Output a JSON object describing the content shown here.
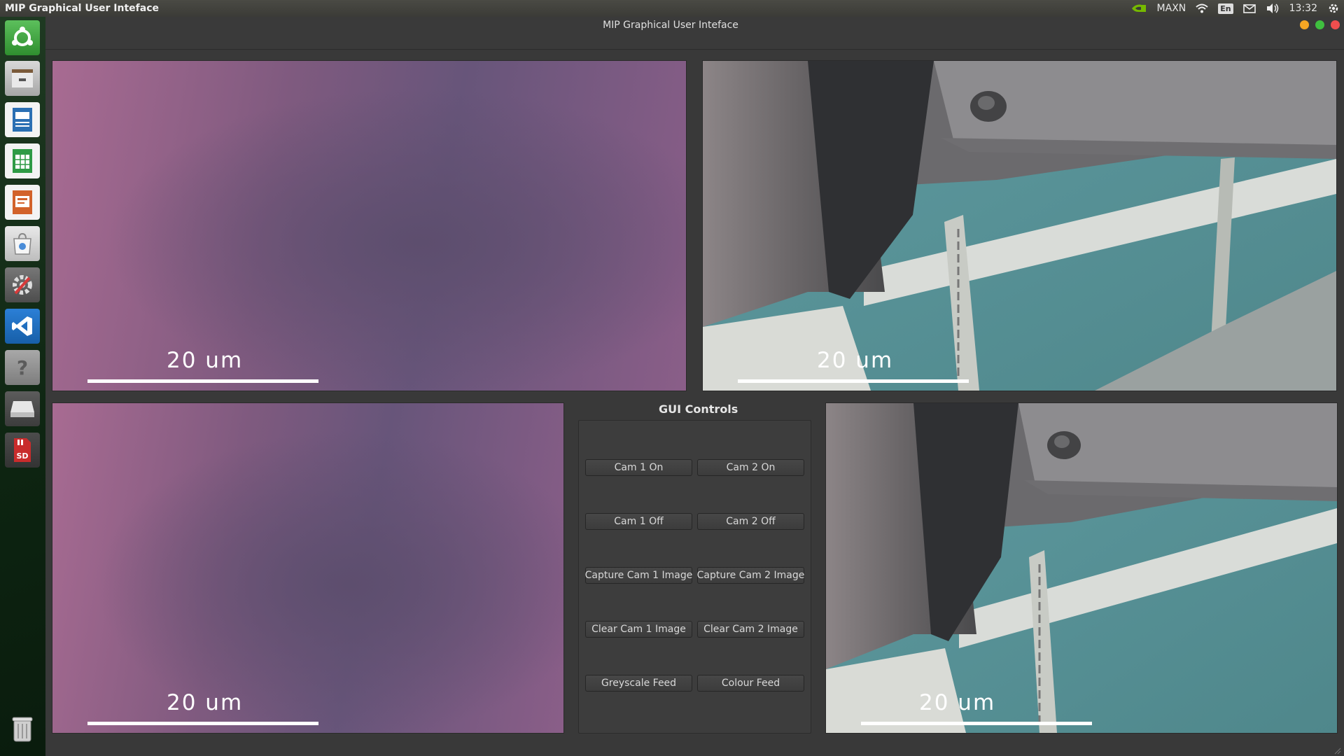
{
  "top_panel": {
    "app_title": "MIP Graphical User Inteface",
    "power_mode": "MAXN",
    "keyboard_layout": "En",
    "clock": "13:32",
    "icons": [
      "nvidia-icon",
      "wifi-icon",
      "keyboard-icon",
      "mail-icon",
      "volume-icon",
      "settings-gear-icon"
    ]
  },
  "launcher": {
    "items": [
      "ubuntu-dash-icon",
      "file-manager-icon",
      "libreoffice-writer-icon",
      "libreoffice-calc-icon",
      "libreoffice-impress-icon",
      "software-center-icon",
      "system-settings-icon",
      "vscode-icon",
      "help-icon",
      "drive-icon",
      "sd-card-icon",
      "trash-icon"
    ]
  },
  "window": {
    "title": "MIP Graphical User Inteface",
    "close_color": "#f04e4e",
    "minimize_color": "#f5a623",
    "maximize_color": "#3fbf3f"
  },
  "views": {
    "cam1_feed": {
      "scale_label": "20  um"
    },
    "cam2_feed": {
      "scale_label": "20  um"
    },
    "cam1_capture": {
      "scale_label": "20  um"
    },
    "cam2_capture": {
      "scale_label": "20  um"
    }
  },
  "controls": {
    "title": "GUI Controls",
    "cam1_on": "Cam 1 On",
    "cam2_on": "Cam 2 On",
    "cam1_off": "Cam 1 Off",
    "cam2_off": "Cam 2 Off",
    "capture_cam1": "Capture Cam 1 Image",
    "capture_cam2": "Capture Cam 2 Image",
    "clear_cam1": "Clear Cam 1 Image",
    "clear_cam2": "Clear Cam 2 Image",
    "greyscale": "Greyscale Feed",
    "colour": "Colour Feed"
  }
}
